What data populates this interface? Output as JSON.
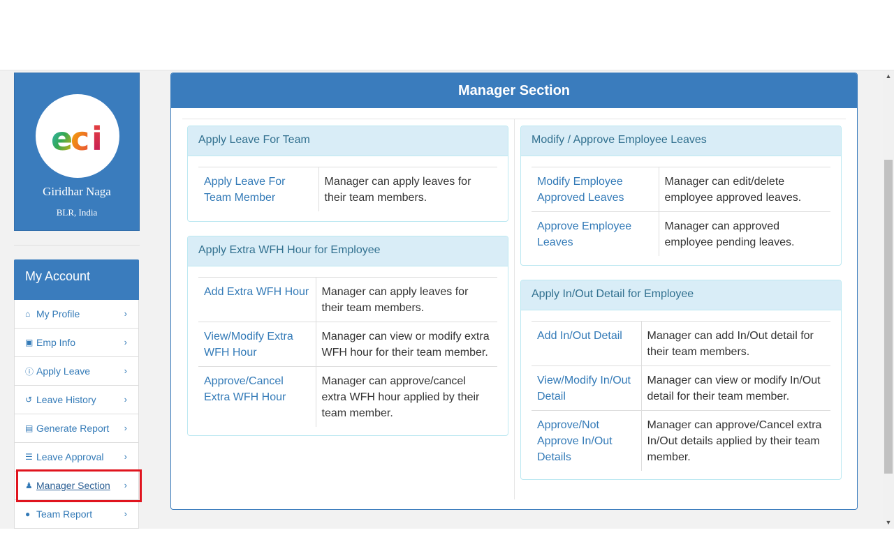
{
  "profile": {
    "name": "Giridhar Naga",
    "location": "BLR, India",
    "logo_text": "eci"
  },
  "account": {
    "title": "My Account",
    "items": [
      {
        "label": "My Profile",
        "icon": "home-icon"
      },
      {
        "label": "Emp Info",
        "icon": "lock-icon"
      },
      {
        "label": "Apply Leave",
        "icon": "info-circle-icon"
      },
      {
        "label": "Leave History",
        "icon": "history-icon"
      },
      {
        "label": "Generate Report",
        "icon": "file-excel-icon"
      },
      {
        "label": "Leave Approval",
        "icon": "list-icon"
      },
      {
        "label": "Manager Section",
        "icon": "user-secret-icon"
      },
      {
        "label": "Team Report",
        "icon": "users-icon"
      }
    ]
  },
  "main": {
    "title": "Manager Section",
    "panels": {
      "apply_leave_team": {
        "title": "Apply Leave For Team",
        "rows": [
          {
            "link": "Apply Leave For Team Member",
            "desc": "Manager can apply leaves for their team members."
          }
        ]
      },
      "extra_wfh": {
        "title": "Apply Extra WFH Hour for Employee",
        "rows": [
          {
            "link": "Add Extra WFH Hour",
            "desc": "Manager can apply leaves for their team members."
          },
          {
            "link": "View/Modify Extra WFH Hour",
            "desc": "Manager can view or modify extra WFH hour for their team member."
          },
          {
            "link": "Approve/Cancel Extra WFH Hour",
            "desc": "Manager can approve/cancel extra WFH hour applied by their team member."
          }
        ]
      },
      "modify_approve": {
        "title": "Modify / Approve Employee Leaves",
        "rows": [
          {
            "link": "Modify Employee Approved Leaves",
            "desc": "Manager can edit/delete employee approved leaves."
          },
          {
            "link": "Approve Employee Leaves",
            "desc": "Manager can approved employee pending leaves."
          }
        ]
      },
      "inout": {
        "title": "Apply In/Out Detail for Employee",
        "rows": [
          {
            "link": "Add In/Out Detail",
            "desc": "Manager can add In/Out detail for their team members."
          },
          {
            "link": "View/Modify In/Out Detail",
            "desc": "Manager can view or modify In/Out detail for their team member."
          },
          {
            "link": "Approve/Not Approve In/Out Details",
            "desc": "Manager can approve/Cancel extra In/Out details applied by their team member."
          }
        ]
      }
    }
  },
  "colors": {
    "primary": "#3a7cbd",
    "link": "#337ab7",
    "info_bg": "#d9edf7",
    "info_text": "#31708f",
    "highlight": "#e0141e"
  }
}
